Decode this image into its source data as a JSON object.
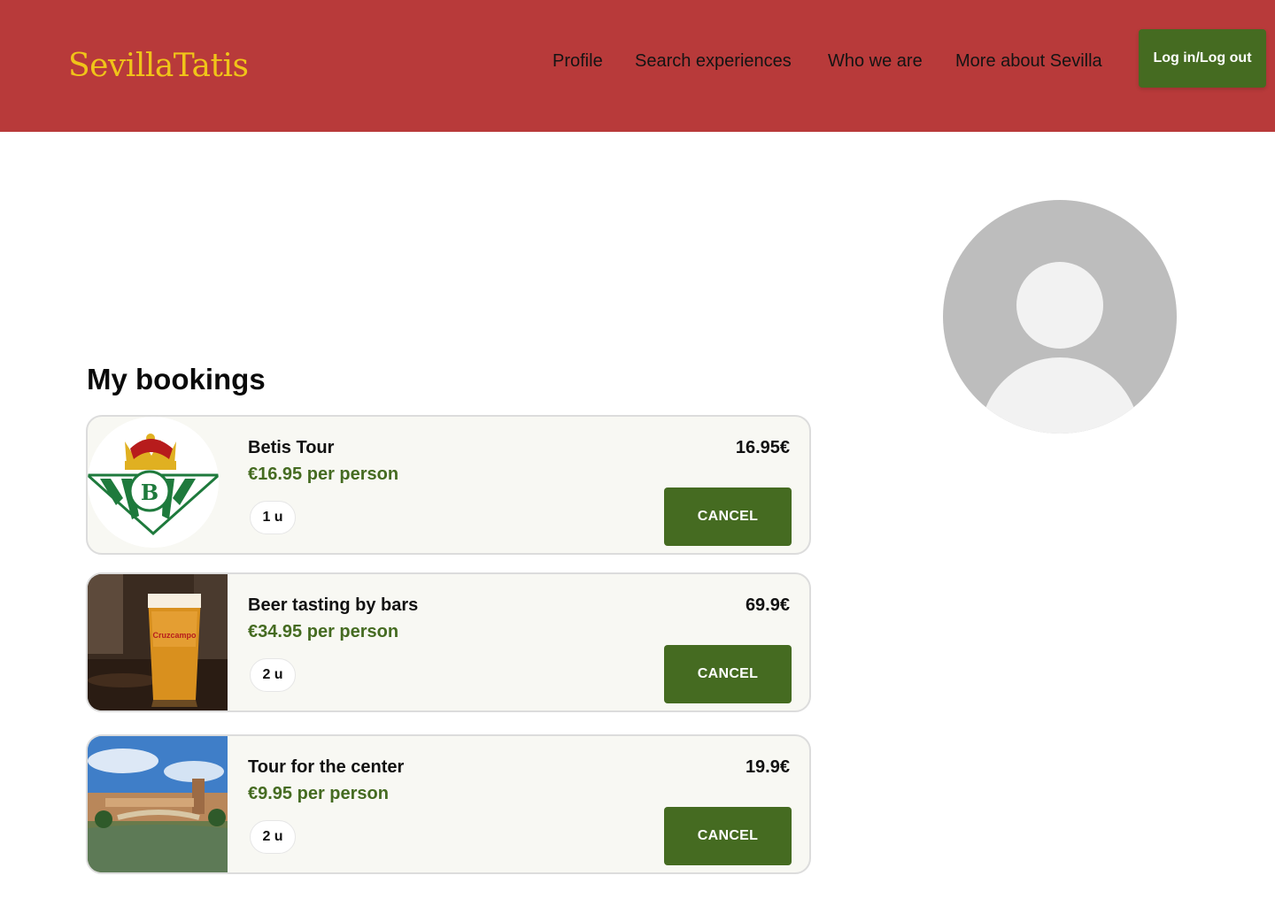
{
  "header": {
    "logo": "SevillaTatis",
    "nav": [
      "Profile",
      "Search experiences",
      "Who we are",
      "More about Sevilla"
    ],
    "login_label": "Log in/Log out",
    "colors": {
      "background": "#b83a3a",
      "logo": "#f0c419",
      "button": "#456b21"
    }
  },
  "main": {
    "section_title": "My bookings",
    "bookings": [
      {
        "title": "Betis Tour",
        "price": "€16.95 per person",
        "qty": "1 u",
        "total": "16.95€",
        "cancel": "CANCEL",
        "image": "betis-crest"
      },
      {
        "title": "Beer tasting by bars",
        "price": "€34.95 per person",
        "qty": "2 u",
        "total": "69.9€",
        "cancel": "CANCEL",
        "image": "beer-glass-photo"
      },
      {
        "title": "Tour for the center",
        "price": "€9.95 per person",
        "qty": "2 u",
        "total": "19.9€",
        "cancel": "CANCEL",
        "image": "plaza-espana-photo"
      }
    ]
  },
  "profile": {
    "avatar_icon": "user-placeholder-icon"
  }
}
